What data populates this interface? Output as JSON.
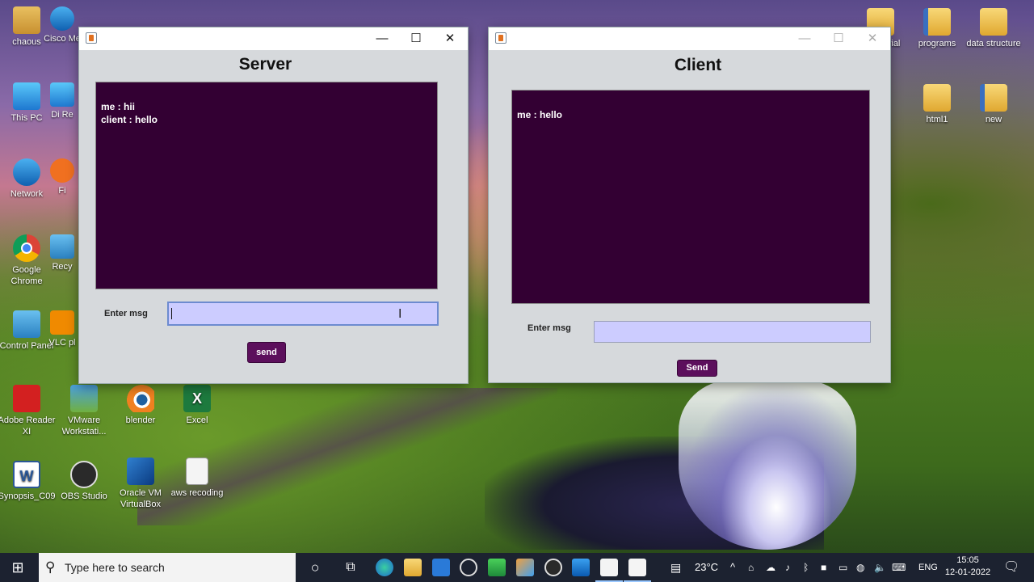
{
  "desktop": {
    "left_icons": [
      {
        "label": "chaous",
        "icon": "user-folder-icon"
      },
      {
        "label": "This PC",
        "icon": "computer-icon"
      },
      {
        "label": "Network",
        "icon": "network-icon"
      },
      {
        "label": "Google Chrome",
        "icon": "chrome-icon"
      },
      {
        "label": "Control Panel",
        "icon": "control-panel-icon"
      },
      {
        "label": "Adobe Reader XI",
        "icon": "pdf-icon"
      },
      {
        "label": "Synopsis_C09",
        "icon": "word-doc-icon"
      }
    ],
    "second_col_partial": [
      {
        "label": "Cisco Me",
        "icon": "cisco-icon"
      },
      {
        "label": "Di Re",
        "icon": "app-icon"
      },
      {
        "label": "Fi",
        "icon": "firefox-icon"
      },
      {
        "label": "Recy",
        "icon": "recycle-bin-icon"
      },
      {
        "label": "VLC pl",
        "icon": "vlc-icon"
      }
    ],
    "bottom_row_icons": [
      {
        "label": "VMware Workstati...",
        "icon": "vmware-icon"
      },
      {
        "label": "blender",
        "icon": "blender-icon"
      },
      {
        "label": "Excel",
        "icon": "excel-icon"
      },
      {
        "label": "OBS Studio",
        "icon": "obs-icon"
      },
      {
        "label": "Oracle VM VirtualBox",
        "icon": "virtualbox-icon"
      },
      {
        "label": "aws recoding",
        "icon": "text-file-icon"
      }
    ],
    "right_icons": [
      {
        "label": "programs",
        "icon": "folder-icon"
      },
      {
        "label": "data structure",
        "icon": "folder-icon"
      },
      {
        "label": "html1",
        "icon": "folder-icon"
      },
      {
        "label": "new",
        "icon": "folder-icon"
      },
      {
        "label": "orial",
        "icon": "folder-icon"
      }
    ],
    "word_glyph": "W",
    "excel_glyph": "X"
  },
  "server_window": {
    "heading": "Server",
    "messages": [
      "me : hii",
      "client : hello"
    ],
    "input_label": "Enter msg",
    "input_value": "",
    "send_label": "send",
    "controls": {
      "minimize": "—",
      "maximize": "☐",
      "close": "✕"
    }
  },
  "client_window": {
    "heading": "Client",
    "messages": [
      "me : hello"
    ],
    "input_label": "Enter msg",
    "input_value": "",
    "send_label": "Send",
    "controls": {
      "minimize": "—",
      "maximize": "☐",
      "close": "✕"
    }
  },
  "taskbar": {
    "start_glyph": "⊞",
    "search_placeholder": "Type here to search",
    "search_glyph": "⚲",
    "cortana_glyph": "○",
    "taskview_glyph": "⧉",
    "weather": "23°C",
    "language": "ENG",
    "time": "15:05",
    "date": "12-01-2022",
    "tray_glyphs": {
      "chevron": "^",
      "volume": "🔈",
      "notifications": "🗨"
    }
  },
  "colors": {
    "chat_bg": "#330033",
    "input_bg": "#ccccff",
    "button_bg": "#5c0f5c",
    "taskbar_bg": "#1c2230"
  }
}
